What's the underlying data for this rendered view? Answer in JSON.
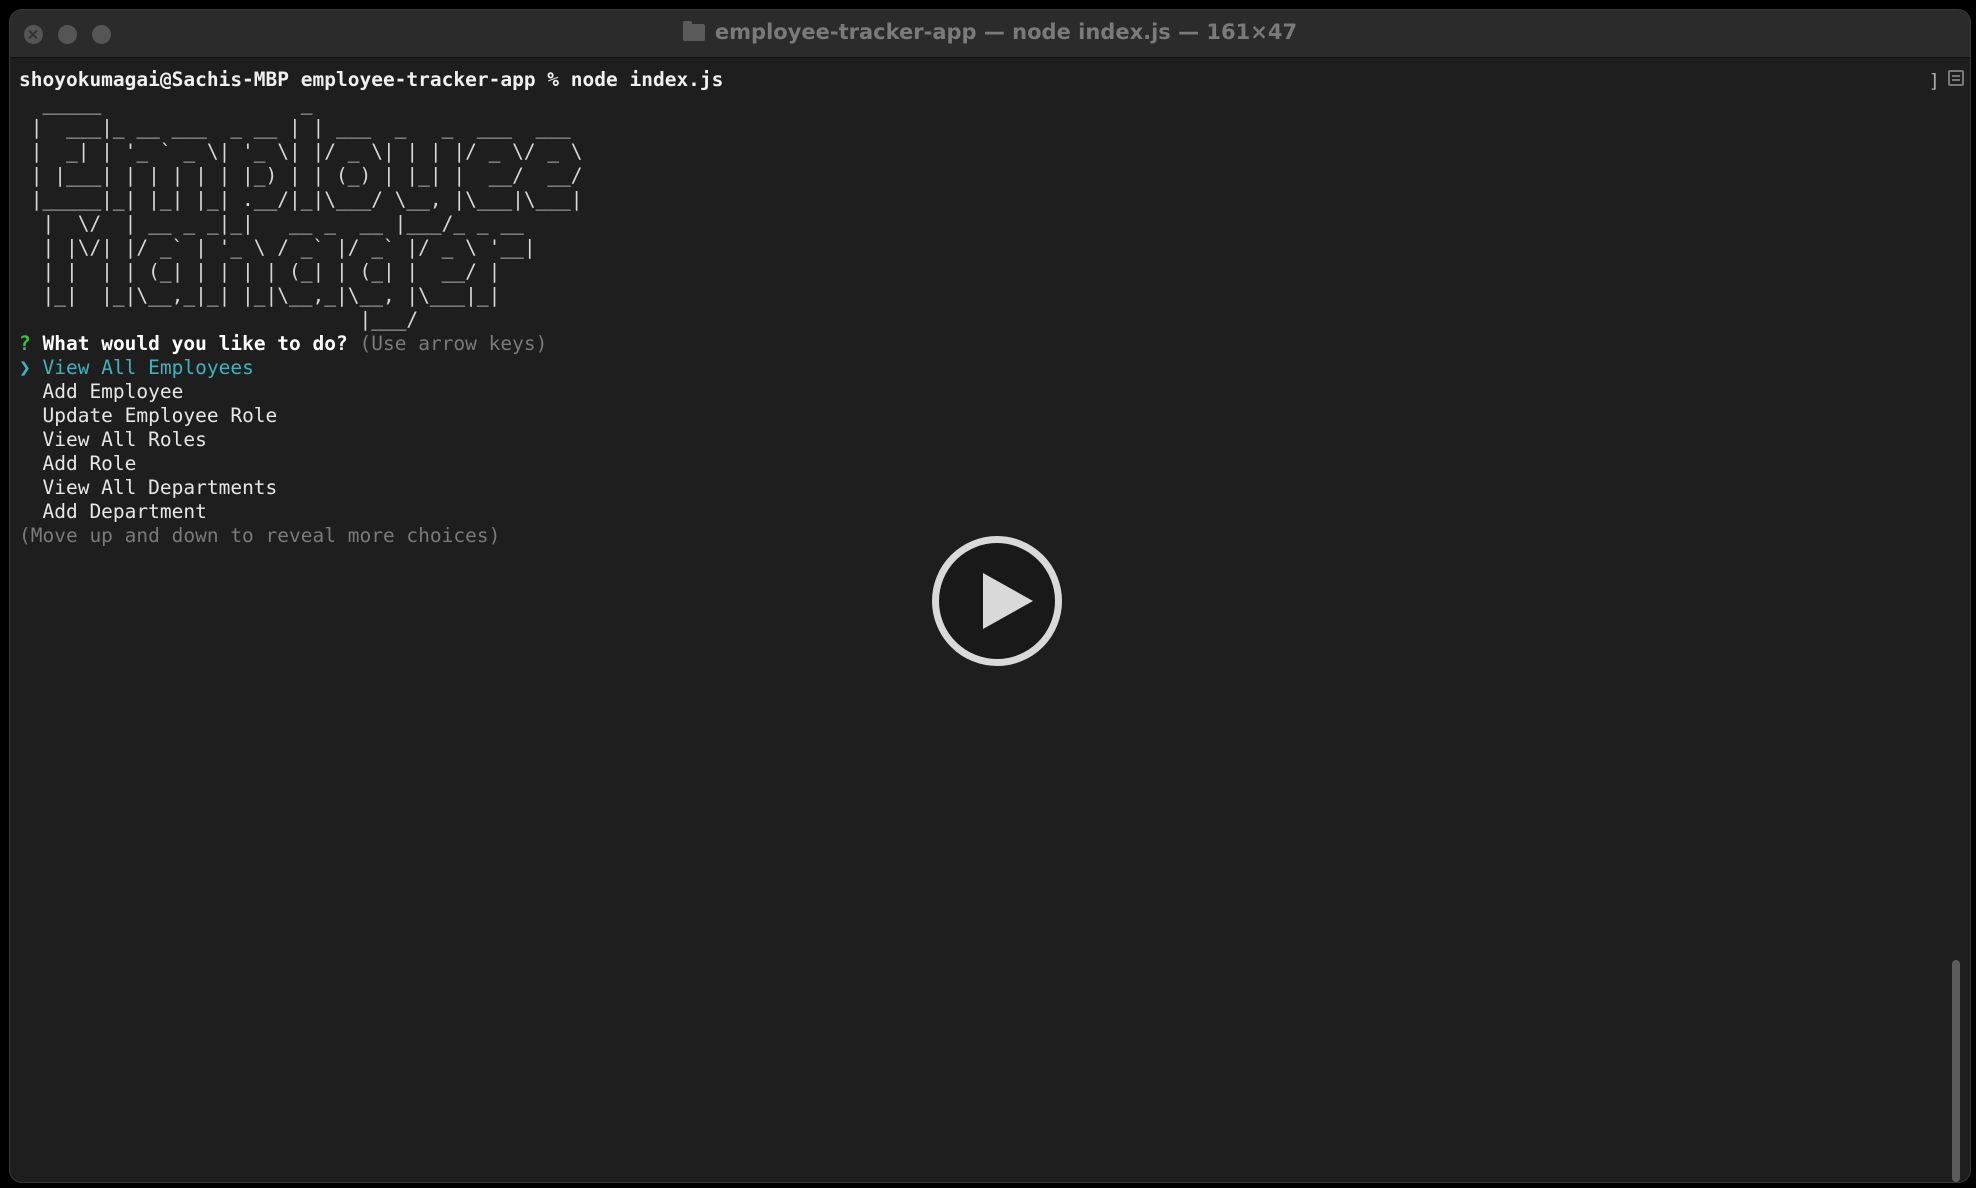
{
  "window": {
    "title": "employee-tracker-app — node index.js — 161×47"
  },
  "terminal": {
    "command_line": "shoyokumagai@Sachis-MBP employee-tracker-app % node index.js",
    "banner_lines": [
      "  _____                 _",
      " |  ___|_ __ ___  _ __ | | ___  _   _  ___  ___",
      " |  _| | '_ ` _ \\| '_ \\| |/ _ \\| | | |/ _ \\/ _ \\",
      " | |___| | | | | | |_) | | (_) | |_| |  __/  __/",
      " |_____|_| |_| |_| .__/|_|\\___/ \\__, |\\___|\\___|",
      "  |  \\/  | __ _ _|_|   __ _  __ |___/_ _ __",
      "  | |\\/| |/ _` | '_ \\ / _` |/ _` |/ _ \\ '__|",
      "  | |  | | (_| | | | | (_| | (_| |  __/ |",
      "  |_|  |_|\\__,_|_| |_|\\__,_|\\__, |\\___|_|",
      "                             |___/"
    ],
    "question_mark": "?",
    "question": "What would you like to do?",
    "question_hint": "(Use arrow keys)",
    "pointer": "❯",
    "choices": [
      "View All Employees",
      "Add Employee",
      "Update Employee Role",
      "View All Roles",
      "Add Role",
      "View All Departments",
      "Add Department"
    ],
    "selected_index": 0,
    "more_choices_hint": "(Move up and down to reveal more choices)"
  },
  "colors": {
    "background": "#1e1e1e",
    "selected": "#3bb4c0",
    "question_mark": "#3fbf3f",
    "hint": "#7a7a7a"
  },
  "overlay": {
    "icon": "play-icon"
  }
}
